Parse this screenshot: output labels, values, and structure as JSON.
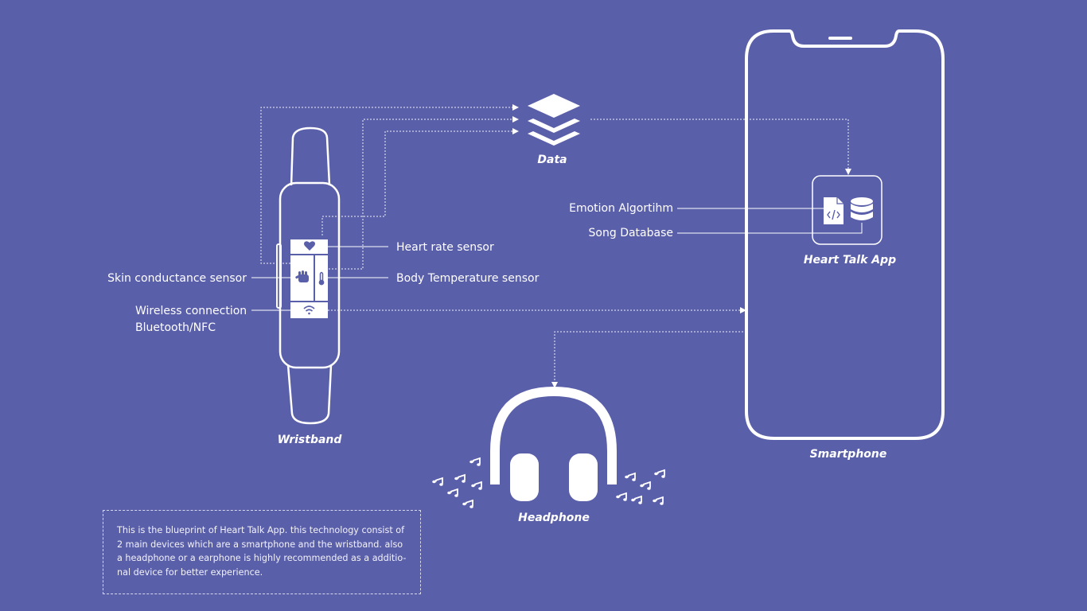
{
  "colors": {
    "background": "#5A5FAA",
    "foreground": "#FFFFFF"
  },
  "labels": {
    "data": "Data",
    "wristband": "Wristband",
    "smartphone": "Smartphone",
    "headphone": "Headphone",
    "heart_talk_app": "Heart Talk App",
    "emotion_algorithm": "Emotion Algortihm",
    "song_database": "Song Database",
    "heart_rate_sensor": "Heart rate sensor",
    "body_temperature_sensor": "Body Temperature sensor",
    "skin_conductance_sensor": "Skin conductance sensor",
    "wireless_connection": "Wireless connection",
    "bluetooth_nfc": "Bluetooth/NFC"
  },
  "description": {
    "lines": [
      "This is the blueprint of Heart Talk App. this technology consist of",
      "2 main devices which are a smartphone and the wristband. also",
      "a headphone or a earphone is highly recommended as a additio-",
      "nal device for better experience."
    ]
  },
  "icons": {
    "data": "stacked-layers-icon",
    "heart_rate": "heart-icon",
    "skin_conductance": "hand-icon",
    "body_temperature": "thermometer-icon",
    "wireless": "wifi-icon",
    "code_file": "code-file-icon",
    "database": "database-icon",
    "music_notes": "music-note-icon"
  }
}
